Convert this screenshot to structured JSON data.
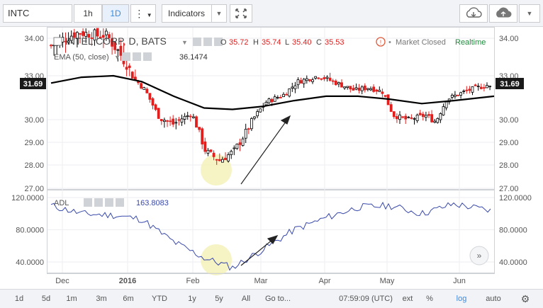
{
  "toolbar": {
    "symbol": "INTC",
    "interval_1h": "1h",
    "interval_1d": "1D",
    "indicators_label": "Indicators"
  },
  "legend": {
    "title": "INTEL CORP, D, BATS",
    "o_label": "O",
    "o_value": "35.72",
    "h_label": "H",
    "h_value": "35.74",
    "l_label": "L",
    "l_value": "35.40",
    "c_label": "C",
    "c_value": "35.53",
    "market_status": "Market Closed",
    "realtime": "Realtime",
    "ema_label": "EMA (50, close)",
    "ema_value": "36.1474",
    "adl_label": "ADL",
    "adl_value": "163.8083"
  },
  "price_axis": {
    "ticks": [
      "34.00",
      "33.00",
      "30.00",
      "29.00",
      "28.00",
      "27.00"
    ],
    "tick_values": [
      34,
      33,
      30,
      29,
      28,
      27
    ],
    "current_price": "31.69"
  },
  "adl_axis": {
    "ticks": [
      "120.0000",
      "80.0000",
      "40.0000"
    ],
    "tick_values": [
      120,
      80,
      40
    ]
  },
  "time_axis": {
    "labels": [
      "Dec",
      "2016",
      "Feb",
      "Mar",
      "Apr",
      "May",
      "Jun"
    ]
  },
  "bottom": {
    "ranges": [
      "1d",
      "5d",
      "1m",
      "3m",
      "6m",
      "YTD",
      "1y",
      "5y",
      "All"
    ],
    "goto": "Go to...",
    "clock": "07:59:09 (UTC)",
    "ext": "ext",
    "percent": "%",
    "log": "log",
    "auto": "auto"
  },
  "colors": {
    "up": "#000000",
    "down": "#e0201f",
    "ema": "#000000",
    "adl": "#3949ab",
    "highlight": "#f3efb0",
    "accent": "#3a8be0",
    "realtime": "#1e8a3c"
  },
  "chart_data": [
    {
      "type": "line",
      "title": "INTEL CORP, D, BATS",
      "series": [
        {
          "name": "EMA (50, close)",
          "x": [
            "Nov 25",
            "Dec 10",
            "Dec 28",
            "Jan 12",
            "Jan 27",
            "Feb 10",
            "Feb 24",
            "Mar 9",
            "Mar 23",
            "Apr 6",
            "Apr 20",
            "May 4",
            "May 18",
            "Jun 1",
            "Jun 15"
          ],
          "values": [
            32.5,
            32.9,
            33.0,
            32.6,
            31.6,
            30.8,
            30.7,
            30.9,
            31.3,
            31.6,
            31.6,
            31.4,
            31.1,
            31.3,
            31.6
          ]
        }
      ],
      "ylim": [
        27,
        34.5
      ]
    },
    {
      "type": "line",
      "series": [
        {
          "name": "ADL",
          "x": [
            "Nov 25",
            "Dec 10",
            "Dec 28",
            "Jan 12",
            "Jan 27",
            "Feb 10",
            "Feb 24",
            "Mar 9",
            "Mar 23",
            "Apr 6",
            "Apr 20",
            "May 4",
            "May 18",
            "Jun 1",
            "Jun 15"
          ],
          "values": [
            110,
            100,
            98,
            93,
            65,
            45,
            33,
            55,
            80,
            95,
            108,
            110,
            100,
            112,
            103
          ]
        }
      ],
      "ylim": [
        30,
        125
      ]
    }
  ]
}
